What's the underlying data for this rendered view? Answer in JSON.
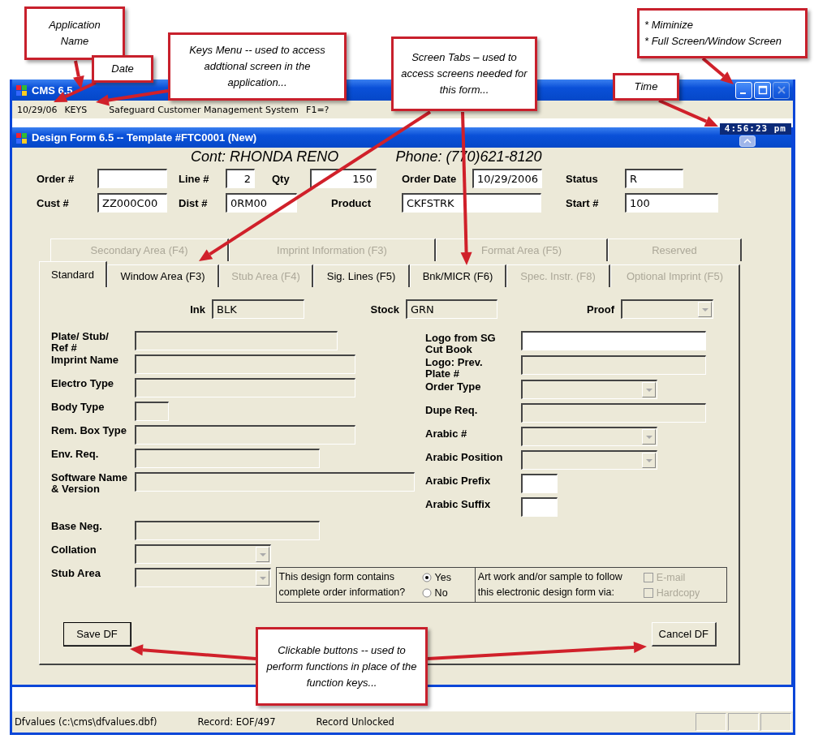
{
  "callouts": [
    {
      "lines": [
        "Application",
        "Name"
      ]
    },
    {
      "lines": [
        "Date"
      ]
    },
    {
      "lines": [
        "Keys Menu -- used to access addtional screen in the application..."
      ]
    },
    {
      "lines": [
        "Screen Tabs – used to access screens needed for this form..."
      ]
    },
    {
      "lines": [
        "Time"
      ]
    },
    {
      "lines": [
        "* Miminize",
        "* Full Screen/Window Screen"
      ]
    },
    {
      "lines": [
        "Clickable buttons -- used to perform functions in place of the function keys..."
      ]
    }
  ],
  "app_window": {
    "title": "CMS 6.5",
    "buttons": [
      {
        "kind": "minimize",
        "disabled": false
      },
      {
        "kind": "maximize",
        "disabled": false
      },
      {
        "kind": "close",
        "disabled": true
      }
    ]
  },
  "menu_bar": {
    "date": "10/29/06",
    "keys": "KEYS",
    "system": "Safeguard Customer Management System",
    "help": "F1=?"
  },
  "time": "4:56:23 pm",
  "form_window": {
    "title": "Design Form 6.5 -- Template #FTC0001 (New)"
  },
  "contact": "Cont: RHONDA RENO",
  "phone": "Phone: (770)621-8120",
  "header_rows": [
    [
      {
        "label": "Order #",
        "kind": "text"
      },
      {
        "label": "Line #",
        "value": "2",
        "kind": "number"
      },
      {
        "label": "Qty",
        "value": "150",
        "kind": "number"
      },
      {
        "label": "Order Date",
        "value": "10/29/2006",
        "kind": "text"
      },
      {
        "label": "Status",
        "value": "R",
        "kind": "text"
      }
    ],
    [
      {
        "label": "Cust #",
        "value": "ZZ000C00",
        "kind": "text"
      },
      {
        "label": "Dist #",
        "value": "0RM00",
        "kind": "text"
      },
      {
        "label": "Product",
        "value": "CKFSTRK",
        "kind": "text"
      },
      {
        "label": "Start #",
        "value": "100",
        "kind": "text"
      }
    ]
  ],
  "tabs_top": [
    {
      "label": "Secondary Area (F4)",
      "disabled": true
    },
    {
      "label": "Imprint Information (F3)",
      "disabled": true
    },
    {
      "label": "Format Area (F5)",
      "disabled": true
    },
    {
      "label": "Reserved",
      "disabled": true
    }
  ],
  "tabs": [
    {
      "label": "Standard",
      "selected": true,
      "disabled": false
    },
    {
      "label": "Window Area (F3)",
      "selected": false,
      "disabled": false
    },
    {
      "label": "Stub Area (F4)",
      "selected": false,
      "disabled": true
    },
    {
      "label": "Sig. Lines (F5)",
      "selected": false,
      "disabled": false
    },
    {
      "label": "Bnk/MICR (F6)",
      "selected": false,
      "disabled": false
    },
    {
      "label": "Spec. Instr. (F8)",
      "selected": false,
      "disabled": true
    },
    {
      "label": "Optional Imprint (F5)",
      "selected": false,
      "disabled": true
    }
  ],
  "top_fields": [
    {
      "label": "Ink",
      "value": "BLK",
      "kind": "text"
    },
    {
      "label": "Stock",
      "value": "GRN",
      "kind": "text"
    },
    {
      "label": "Proof",
      "kind": "dropdown"
    }
  ],
  "left_fields": [
    {
      "label": "Plate/ Stub/ Ref #",
      "kind": "text",
      "disabled": true
    },
    {
      "label": "Imprint Name",
      "kind": "text",
      "disabled": true
    },
    {
      "label": "Electro Type",
      "kind": "text",
      "disabled": true
    },
    {
      "label": "Body Type",
      "kind": "text",
      "disabled": true
    },
    {
      "label": "Rem. Box Type",
      "kind": "text",
      "disabled": true
    },
    {
      "label": "Env. Req.",
      "kind": "text",
      "disabled": true
    },
    {
      "label": "Software Name & Version",
      "kind": "text",
      "disabled": true
    },
    {
      "label": "Base Neg.",
      "kind": "text",
      "disabled": true
    },
    {
      "label": "Collation",
      "kind": "dropdown",
      "disabled": true
    },
    {
      "label": "Stub Area",
      "kind": "dropdown",
      "disabled": true
    }
  ],
  "right_fields": [
    {
      "label": "Logo from SG Cut Book",
      "kind": "text",
      "disabled": false
    },
    {
      "label": "Logo: Prev. Plate #",
      "kind": "text",
      "disabled": true
    },
    {
      "label": "Order Type",
      "kind": "dropdown",
      "disabled": true
    },
    {
      "label": "Dupe Req.",
      "kind": "text",
      "disabled": true
    },
    {
      "label": "Arabic #",
      "kind": "dropdown",
      "disabled": true
    },
    {
      "label": "Arabic Position",
      "kind": "dropdown",
      "disabled": true
    },
    {
      "label": "Arabic Prefix",
      "kind": "text",
      "disabled": false
    },
    {
      "label": "Arabic Suffix",
      "kind": "text",
      "disabled": false
    }
  ],
  "question": {
    "text": "This design form contains complete order information?",
    "options": [
      {
        "label": "Yes",
        "selected": true
      },
      {
        "label": "No",
        "selected": false
      }
    ]
  },
  "artwork": {
    "text": "Art work and/or sample to follow this electronic design form via:",
    "options": [
      {
        "label": "E-mail",
        "checked": false,
        "disabled": true
      },
      {
        "label": "Hardcopy",
        "checked": false,
        "disabled": true
      }
    ]
  },
  "buttons": [
    "Save DF",
    "Cancel DF"
  ],
  "status_bar": [
    "Dfvalues (c:\\cms\\dfvalues.dbf)",
    "Record: EOF/497",
    "Record Unlocked"
  ]
}
